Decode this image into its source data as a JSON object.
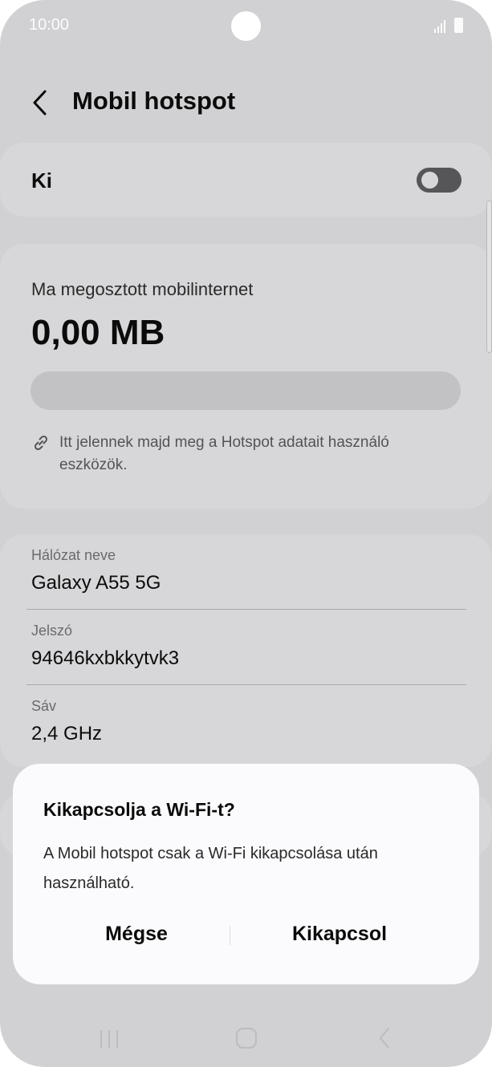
{
  "status_bar": {
    "time": "10:00"
  },
  "header": {
    "title": "Mobil hotspot"
  },
  "hotspot_toggle": {
    "label": "Ki",
    "state": "off"
  },
  "usage": {
    "title": "Ma megosztott mobilinternet",
    "amount": "0,00 MB",
    "hint": "Itt jelennek majd meg a Hotspot adatait használó eszközök."
  },
  "network": {
    "name_label": "Hálózat neve",
    "name_value": "Galaxy A55 5G",
    "password_label": "Jelszó",
    "password_value": "94646kxbkkytvk3",
    "band_label": "Sáv",
    "band_value": "2,4 GHz"
  },
  "dialog": {
    "title": "Kikapcsolja a Wi-Fi-t?",
    "message": "A Mobil hotspot csak a Wi-Fi kikapcsolása után használható.",
    "cancel_label": "Mégse",
    "confirm_label": "Kikapcsol"
  },
  "icons": {
    "back": "chevron-left-icon",
    "link": "link-icon",
    "recents": "recents-icon",
    "home": "home-icon",
    "nav_back": "back-icon"
  },
  "colors": {
    "scrim_background": "#d1d1d3",
    "card": "#d7d7d9",
    "dialog": "#fbfbfd",
    "text": "#0b0b0b"
  }
}
